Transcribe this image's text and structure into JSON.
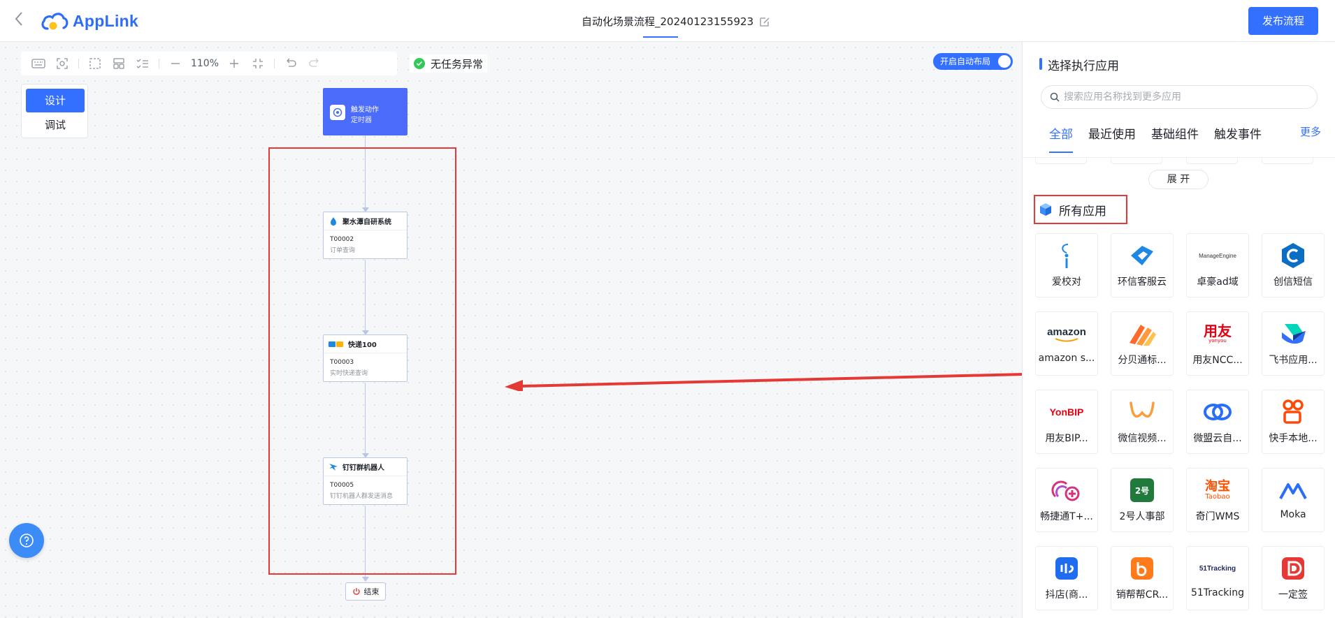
{
  "header": {
    "logo_text": "AppLink",
    "flow_title": "自动化场景流程_20240123155923",
    "publish_label": "发布流程"
  },
  "toolbar": {
    "zoom": "110%",
    "status": "无任务异常",
    "auto_layout": "开启自动布局"
  },
  "mode": {
    "design": "设计",
    "debug": "调试"
  },
  "flow": {
    "trigger": {
      "title": "触发动作",
      "subtitle": "定时器"
    },
    "nodes": [
      {
        "name": "聚水潭自研系统",
        "code": "T00002",
        "desc": "订单查询",
        "icon": "jst-icon"
      },
      {
        "name": "快递100",
        "code": "T00003",
        "desc": "实时快递查询",
        "icon": "kuaidi100-icon"
      },
      {
        "name": "钉钉群机器人",
        "code": "T00005",
        "desc": "钉钉机器人群发送消息",
        "icon": "dingtalk-icon"
      }
    ],
    "end": "结束"
  },
  "panel": {
    "title": "选择执行应用",
    "search_placeholder": "搜索应用名称找到更多应用",
    "tabs": [
      "全部",
      "最近使用",
      "基础组件",
      "触发事件"
    ],
    "more": "更多",
    "expand": "展 开",
    "section": "所有应用",
    "apps": [
      {
        "label": "爱校对",
        "icon": "aixiaodui-icon",
        "color": "#1e88e5"
      },
      {
        "label": "环信客服云",
        "icon": "huanxin-icon",
        "color": "#1e88e5"
      },
      {
        "label": "卓豪ad域",
        "icon": "manageengine-icon",
        "color": "#333333",
        "logo_text": "ManageEngine"
      },
      {
        "label": "创信短信",
        "icon": "chuangxin-icon",
        "color": "#0a6fc2"
      },
      {
        "label": "amazon s...",
        "icon": "amazon-icon",
        "color": "#232f3e",
        "logo_text": "amazon"
      },
      {
        "label": "分贝通标...",
        "icon": "fenbeitong-icon",
        "color": "#ff6a2b"
      },
      {
        "label": "用友NCC...",
        "icon": "yonyou-ncc-icon",
        "color": "#e60012",
        "logo_text": "用友",
        "logo_sub": "yonyou"
      },
      {
        "label": "飞书应用...",
        "icon": "feishu-icon",
        "color": "#3370ff"
      },
      {
        "label": "用友BIP...",
        "icon": "yonbip-icon",
        "color": "#e60012",
        "logo_text": "YonBIP"
      },
      {
        "label": "微信视频...",
        "icon": "wechat-channels-icon",
        "color": "#fa9d3b"
      },
      {
        "label": "微盟云自...",
        "icon": "weimob-icon",
        "color": "#2b6ef6"
      },
      {
        "label": "快手本地...",
        "icon": "kuaishou-icon",
        "color": "#ff4906"
      },
      {
        "label": "畅捷通T+...",
        "icon": "chanjet-icon",
        "color": "#d6337a"
      },
      {
        "label": "2号人事部",
        "icon": "2hao-icon",
        "color": "#1f7a3b",
        "logo_text": "2号"
      },
      {
        "label": "奇门WMS",
        "icon": "taobao-icon",
        "color": "#ff5000",
        "logo_text": "淘宝",
        "logo_sub": "Taobao"
      },
      {
        "label": "Moka",
        "icon": "moka-icon",
        "color": "#2b6ef6"
      },
      {
        "label": "抖店(商...",
        "icon": "doudian-icon",
        "color": "#1f6cf0"
      },
      {
        "label": "销帮帮CR...",
        "icon": "xiaobangbang-icon",
        "color": "#ff7a1a"
      },
      {
        "label": "51Tracking",
        "icon": "51tracking-icon",
        "color": "#1f2a5c",
        "logo_text": "51Tracking"
      },
      {
        "label": "一定签",
        "icon": "yidingqian-icon",
        "color": "#e53935"
      }
    ]
  },
  "colors": {
    "primary": "#3370ff",
    "annotation_red": "#e53935",
    "success": "#34c759"
  }
}
